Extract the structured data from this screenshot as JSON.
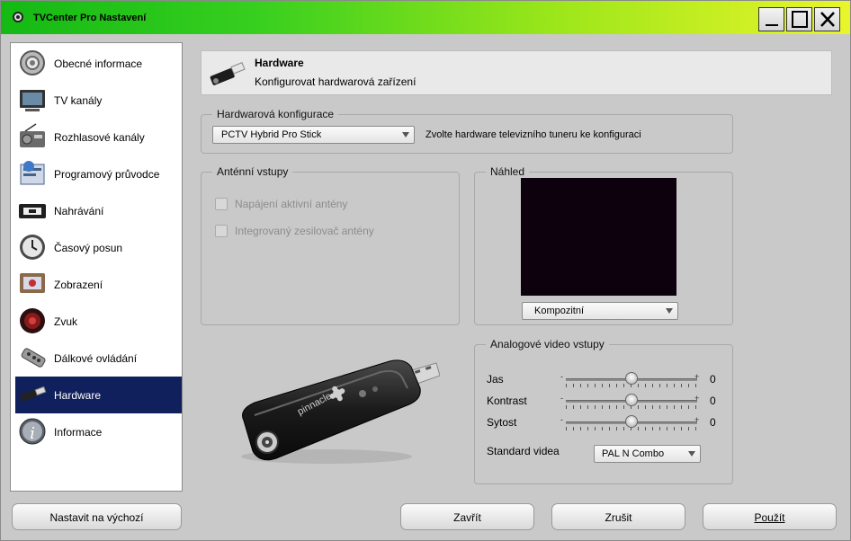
{
  "window": {
    "title": "TVCenter Pro Nastavení"
  },
  "sidebar": {
    "items": [
      {
        "label": "Obecné informace",
        "icon": "gear-icon"
      },
      {
        "label": "TV kanály",
        "icon": "tv-icon"
      },
      {
        "label": "Rozhlasové kanály",
        "icon": "radio-icon"
      },
      {
        "label": "Programový průvodce",
        "icon": "epg-guide-icon"
      },
      {
        "label": "Nahrávání",
        "icon": "video-tape-icon"
      },
      {
        "label": "Časový posun",
        "icon": "clock-icon"
      },
      {
        "label": "Zobrazení",
        "icon": "display-icon"
      },
      {
        "label": "Zvuk",
        "icon": "speaker-icon"
      },
      {
        "label": "Dálkové ovládání",
        "icon": "remote-control-icon"
      },
      {
        "label": "Hardware",
        "icon": "usb-stick-icon",
        "selected": true
      },
      {
        "label": "Informace",
        "icon": "info-icon"
      }
    ]
  },
  "header": {
    "title": "Hardware",
    "subtitle": "Konfigurovat hardwarová zařízení"
  },
  "hw_config": {
    "legend": "Hardwarová konfigurace",
    "selected_device": "PCTV Hybrid Pro Stick",
    "hint": "Zvolte hardware televizního tuneru ke konfiguraci"
  },
  "antenna": {
    "legend": "Anténní vstupy",
    "options": [
      {
        "label": "Napájení aktivní antény",
        "checked": false,
        "enabled": false
      },
      {
        "label": "Integrovaný zesilovač antény",
        "checked": false,
        "enabled": false
      }
    ]
  },
  "preview": {
    "legend": "Náhled",
    "source": "Kompozitní"
  },
  "analog_video": {
    "legend": "Analogové video vstupy",
    "sliders": [
      {
        "label": "Jas",
        "value": "0",
        "level": 0.5
      },
      {
        "label": "Kontrast",
        "value": "0",
        "level": 0.5
      },
      {
        "label": "Sytost",
        "value": "0",
        "level": 0.5
      }
    ],
    "standard_label": "Standard videa",
    "standard_value": "PAL N Combo"
  },
  "device_image": {
    "brand": "pinnacle"
  },
  "buttons": {
    "reset": "Nastavit na výchozí",
    "close": "Zavřít",
    "cancel": "Zrušit",
    "apply": "Použít"
  },
  "colors": {
    "selected_bg": "#10205c",
    "title_gradient_start": "#14b914",
    "title_gradient_end": "#e9f52a"
  }
}
